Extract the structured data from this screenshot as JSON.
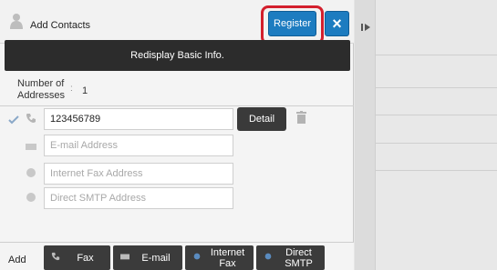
{
  "header": {
    "title": "Add Contacts",
    "register_label": "Register",
    "close_icon": "×"
  },
  "redisplay_label": "Redisplay Basic Info.",
  "addresses": {
    "label": "Number of Addresses",
    "separator": ":",
    "count": "1"
  },
  "fields": {
    "fax": {
      "value": "123456789"
    },
    "email": {
      "placeholder": "E-mail Address"
    },
    "internet_fax": {
      "placeholder": "Internet Fax Address"
    },
    "direct_smtp": {
      "placeholder": "Direct SMTP Address"
    }
  },
  "detail_label": "Detail",
  "footer": {
    "add_label": "Add",
    "buttons": [
      {
        "label": "Fax",
        "icon": "phone-icon"
      },
      {
        "label": "E-mail",
        "icon": "mail-icon"
      },
      {
        "label": "Internet Fax",
        "icon": "internet-fax-icon"
      },
      {
        "label": "Direct SMTP",
        "icon": "direct-smtp-icon"
      }
    ]
  },
  "colors": {
    "accent_blue": "#1d7cc0",
    "highlight_red": "#d31f2d",
    "dark_button": "#3b3b3b"
  }
}
